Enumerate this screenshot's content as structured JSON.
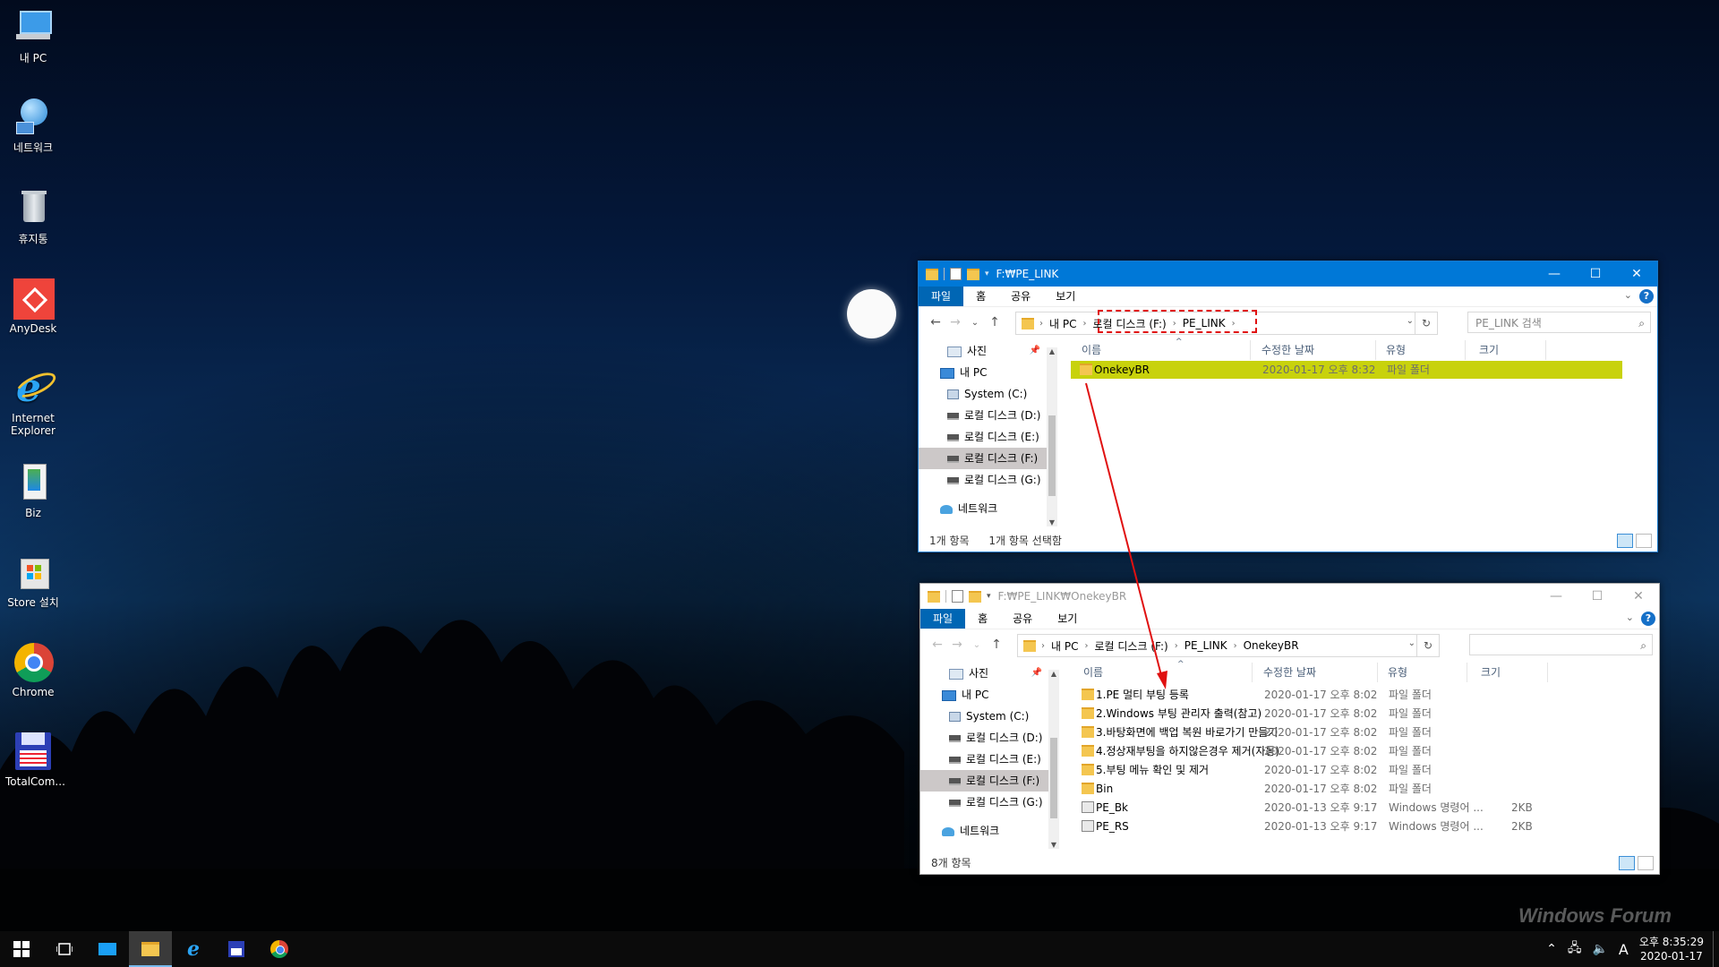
{
  "desktop": {
    "icons": [
      {
        "label": "내 PC",
        "icon": "computer-icon"
      },
      {
        "label": "네트워크",
        "icon": "network-globe-icon"
      },
      {
        "label": "휴지통",
        "icon": "recycle-bin-icon"
      },
      {
        "label": "AnyDesk",
        "icon": "anydesk-icon"
      },
      {
        "label": "Internet Explorer",
        "icon": "internet-explorer-icon"
      },
      {
        "label": "Biz",
        "icon": "biz-book-icon"
      },
      {
        "label": "Store 설치",
        "icon": "store-bag-icon"
      },
      {
        "label": "Chrome",
        "icon": "chrome-icon"
      },
      {
        "label": "TotalCom...",
        "icon": "floppy-disk-icon"
      }
    ]
  },
  "window1": {
    "title": "F:₩PE_LINK",
    "ribbon": {
      "file": "파일",
      "home": "홈",
      "share": "공유",
      "view": "보기"
    },
    "breadcrumb": [
      "내 PC",
      "로컬 디스크 (F:)",
      "PE_LINK"
    ],
    "search_placeholder": "PE_LINK 검색",
    "nav": {
      "pictures": "사진",
      "this_pc": "내 PC",
      "drives": [
        "System (C:)",
        "로컬 디스크 (D:)",
        "로컬 디스크 (E:)",
        "로컬 디스크 (F:)",
        "로컬 디스크 (G:)"
      ],
      "network": "네트워크"
    },
    "columns": {
      "name": "이름",
      "modified": "수정한 날짜",
      "type": "유형",
      "size": "크기"
    },
    "rows": [
      {
        "name": "OnekeyBR",
        "modified": "2020-01-17 오후 8:32",
        "type": "파일 폴더",
        "size": ""
      }
    ],
    "status": {
      "count": "1개 항목",
      "selected": "1개 항목 선택함"
    }
  },
  "window2": {
    "title": "F:₩PE_LINK₩OnekeyBR",
    "ribbon": {
      "file": "파일",
      "home": "홈",
      "share": "공유",
      "view": "보기"
    },
    "breadcrumb": [
      "내 PC",
      "로컬 디스크 (F:)",
      "PE_LINK",
      "OnekeyBR"
    ],
    "search_placeholder": "",
    "nav": {
      "pictures": "사진",
      "this_pc": "내 PC",
      "drives": [
        "System (C:)",
        "로컬 디스크 (D:)",
        "로컬 디스크 (E:)",
        "로컬 디스크 (F:)",
        "로컬 디스크 (G:)"
      ],
      "network": "네트워크"
    },
    "columns": {
      "name": "이름",
      "modified": "수정한 날짜",
      "type": "유형",
      "size": "크기"
    },
    "rows": [
      {
        "name": "1.PE 멀티 부팅 등록",
        "modified": "2020-01-17 오후 8:02",
        "type": "파일 폴더",
        "size": "",
        "kind": "folder"
      },
      {
        "name": "2.Windows 부팅 관리자 출력(참고)",
        "modified": "2020-01-17 오후 8:02",
        "type": "파일 폴더",
        "size": "",
        "kind": "folder"
      },
      {
        "name": "3.바탕화면에 백업 복원 바로가기 만들기",
        "modified": "2020-01-17 오후 8:02",
        "type": "파일 폴더",
        "size": "",
        "kind": "folder"
      },
      {
        "name": "4.정상재부팅을 하지않은경우 제거(자동)",
        "modified": "2020-01-17 오후 8:02",
        "type": "파일 폴더",
        "size": "",
        "kind": "folder"
      },
      {
        "name": "5.부팅 메뉴 확인 및 제거",
        "modified": "2020-01-17 오후 8:02",
        "type": "파일 폴더",
        "size": "",
        "kind": "folder"
      },
      {
        "name": "Bin",
        "modified": "2020-01-17 오후 8:02",
        "type": "파일 폴더",
        "size": "",
        "kind": "folder"
      },
      {
        "name": "PE_Bk",
        "modified": "2020-01-13 오후 9:17",
        "type": "Windows 명령어 ...",
        "size": "2KB",
        "kind": "cmd"
      },
      {
        "name": "PE_RS",
        "modified": "2020-01-13 오후 9:17",
        "type": "Windows 명령어 ...",
        "size": "2KB",
        "kind": "cmd"
      }
    ],
    "status": {
      "count": "8개 항목"
    }
  },
  "taskbar": {
    "items": [
      "start-icon",
      "task-view-icon",
      "desktop-icon",
      "file-explorer-icon",
      "internet-explorer-icon",
      "totalcommander-icon",
      "chrome-icon"
    ],
    "ime": "A",
    "time": "오후 8:35:29",
    "date": "2020-01-17"
  },
  "colors": {
    "titlebar_active": "#0078d7",
    "selection_highlight": "#c8d20c",
    "annotation_red": "#e01010"
  }
}
